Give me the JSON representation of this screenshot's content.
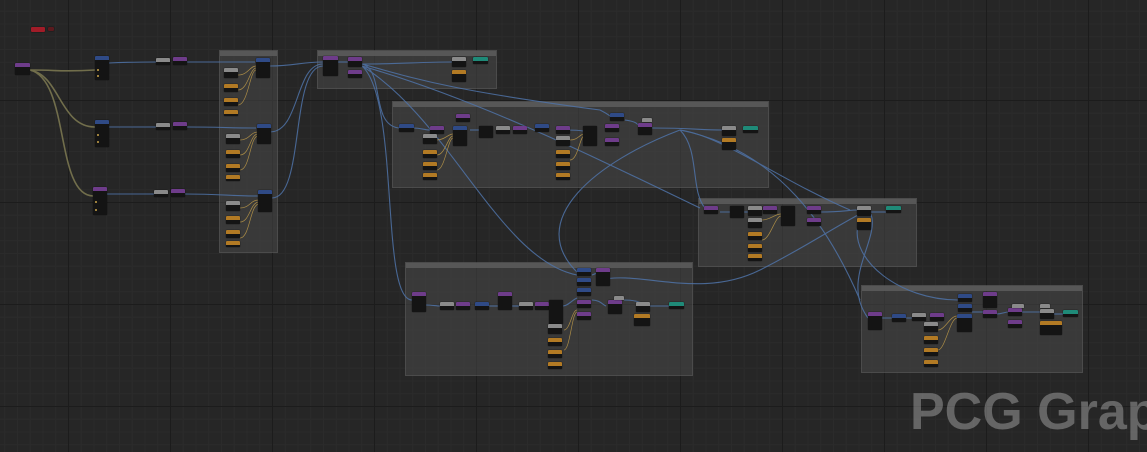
{
  "app": {
    "watermark": "PCG Grap"
  },
  "colors": {
    "background": "#262626",
    "comment_box": "#484848",
    "node_body": "#141414",
    "header_purple": "#6e3c8a",
    "header_blue": "#2f4a86",
    "header_teal": "#1f8a78",
    "header_gray": "#8a8a8a",
    "header_orange": "#b27a24",
    "header_red": "#a11c28",
    "wire_blue": "#4f73a8",
    "wire_olive": "#7a7650"
  },
  "comments": [
    {
      "id": "c1",
      "title": ""
    },
    {
      "id": "c2",
      "title": ""
    },
    {
      "id": "c3",
      "title": ""
    },
    {
      "id": "c4",
      "title": ""
    },
    {
      "id": "c5",
      "title": ""
    },
    {
      "id": "c6",
      "title": ""
    }
  ]
}
